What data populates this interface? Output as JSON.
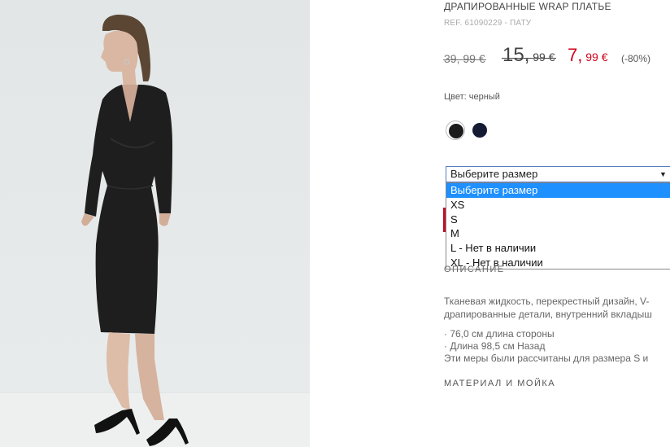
{
  "product": {
    "title": "ДРАПИРОВАННЫЕ WRAP ПЛАТЬЕ",
    "ref": "REF. 61090229 - ПАТУ"
  },
  "prices": {
    "original": "39, 99 €",
    "previous_big": "15,",
    "previous_small": " 99 €",
    "sale_big": "7,",
    "sale_small": " 99 €",
    "discount": "(-80%)"
  },
  "colors": {
    "label": "Цвет: черный",
    "swatches": [
      {
        "name": "black",
        "hex": "#1c1c1c",
        "selected": true
      },
      {
        "name": "navy",
        "hex": "#151b33",
        "selected": false
      }
    ]
  },
  "size_select": {
    "value": "Выберите размер",
    "options": [
      "Выберите размер",
      "XS",
      "S",
      "M",
      "L - Нет в наличии",
      "XL - Нет в наличии"
    ],
    "highlighted_index": 0
  },
  "sections": {
    "description_heading": "ОПИСАНИЕ",
    "description_line1": "Тканевая жидкость, перекрестный дизайн, V-",
    "description_line2": "драпированные детали, внутренний вкладыш",
    "measure1": "· 76,0 см длина стороны",
    "measure2": "· Длина 98,5 см Назад",
    "measure3": "Эти меры были рассчитаны для размера S и",
    "material_heading": "МАТЕРИАЛ И МОЙКА"
  },
  "accent_colors": {
    "sale_red": "#d0021b",
    "highlight_blue": "#1e90ff"
  }
}
